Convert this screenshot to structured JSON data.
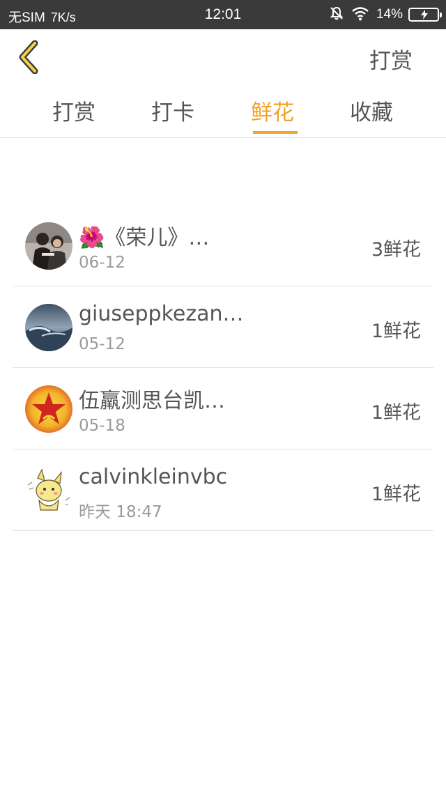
{
  "status_bar": {
    "carrier": "无SIM",
    "speed": "7K/s",
    "time": "12:01",
    "battery": "14%"
  },
  "nav": {
    "action_label": "打赏"
  },
  "tabs": [
    {
      "label": "打赏",
      "active": false
    },
    {
      "label": "打卡",
      "active": false
    },
    {
      "label": "鲜花",
      "active": true
    },
    {
      "label": "收藏",
      "active": false
    }
  ],
  "accent_color": "#f0a32a",
  "items": [
    {
      "name": "🌺《荣儿》…",
      "date": "06-12",
      "count": "3鲜花"
    },
    {
      "name": "giuseppkezan…",
      "date": "05-12",
      "count": "1鲜花"
    },
    {
      "name": "伍羸测思台凯…",
      "date": "05-18",
      "count": "1鲜花"
    },
    {
      "name": "calvinkleinvbc",
      "date": "昨天 18:47",
      "count": "1鲜花"
    }
  ]
}
